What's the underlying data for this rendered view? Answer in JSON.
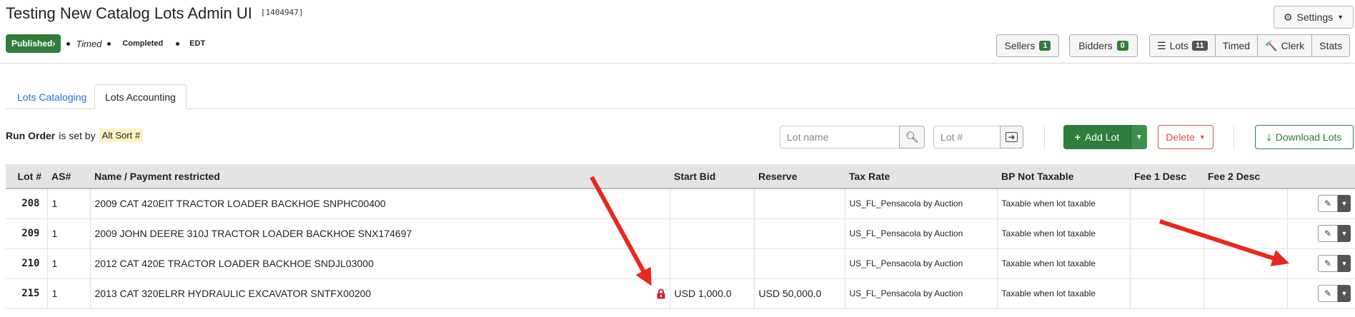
{
  "header": {
    "title": "Testing New Catalog Lots Admin UI",
    "lot_id": "[1404947]",
    "settings_label": "Settings"
  },
  "status": {
    "published": "Published",
    "timed": "Timed",
    "completed": "Completed",
    "timezone": "EDT"
  },
  "nav": {
    "sellers": {
      "label": "Sellers",
      "count": "1"
    },
    "bidders": {
      "label": "Bidders",
      "count": "0"
    },
    "lots": {
      "label": "Lots",
      "count": "11"
    },
    "timed": "Timed",
    "clerk": "Clerk",
    "stats": "Stats"
  },
  "tabs": [
    {
      "label": "Lots Cataloging"
    },
    {
      "label": "Lots Accounting"
    }
  ],
  "toolbar": {
    "run_order_bold": "Run Order",
    "run_order_text": "is set by",
    "alt_sort": "Alt Sort #",
    "lot_name_placeholder": "Lot name",
    "lot_num_placeholder": "Lot #",
    "add_lot": "Add Lot",
    "delete": "Delete",
    "download": "Download Lots"
  },
  "table": {
    "headers": [
      "Lot #",
      "AS#",
      "Name / Payment restricted",
      "Start Bid",
      "Reserve",
      "Tax Rate",
      "BP Not Taxable",
      "Fee 1 Desc",
      "Fee 2 Desc"
    ],
    "rows": [
      {
        "lot": "208",
        "as": "1",
        "name": "2009 CAT 420EIT TRACTOR LOADER BACKHOE SNPHC00400",
        "start_bid": "",
        "reserve": "",
        "tax_rate": "US_FL_Pensacola by Auction",
        "bp": "Taxable when lot taxable",
        "fee1": "",
        "fee2": "",
        "locked": false
      },
      {
        "lot": "209",
        "as": "1",
        "name": "2009 JOHN DEERE 310J TRACTOR LOADER BACKHOE SNX174697",
        "start_bid": "",
        "reserve": "",
        "tax_rate": "US_FL_Pensacola by Auction",
        "bp": "Taxable when lot taxable",
        "fee1": "",
        "fee2": "",
        "locked": false
      },
      {
        "lot": "210",
        "as": "1",
        "name": "2012 CAT 420E TRACTOR LOADER BACKHOE SNDJL03000",
        "start_bid": "",
        "reserve": "",
        "tax_rate": "US_FL_Pensacola by Auction",
        "bp": "Taxable when lot taxable",
        "fee1": "",
        "fee2": "",
        "locked": false
      },
      {
        "lot": "215",
        "as": "1",
        "name": "2013 CAT 320ELRR HYDRAULIC EXCAVATOR SNTFX00200",
        "start_bid": "USD 1,000.0",
        "reserve": "USD 50,000.0",
        "tax_rate": "US_FL_Pensacola by Auction",
        "bp": "Taxable when lot taxable",
        "fee1": "",
        "fee2": "",
        "locked": true
      }
    ]
  },
  "colors": {
    "primary_green": "#2f7d3b",
    "link_blue": "#2a6fd6",
    "danger_red": "#d9534f",
    "annotation_red": "#e8281e"
  }
}
